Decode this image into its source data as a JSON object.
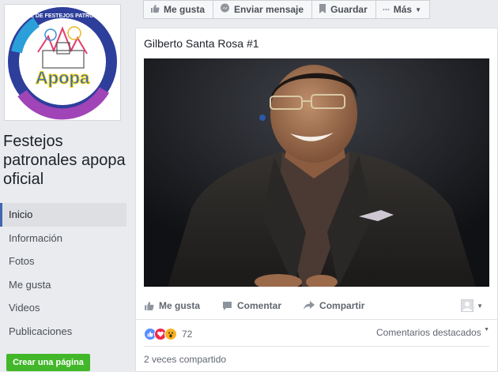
{
  "page": {
    "logo_text_top": "COMITE DE FESTEJOS PATRONALES",
    "logo_text_brand": "Apopa",
    "name": "Festejos patronales apopa oficial"
  },
  "nav": {
    "items": [
      {
        "label": "Inicio",
        "active": true
      },
      {
        "label": "Información"
      },
      {
        "label": "Fotos"
      },
      {
        "label": "Me gusta"
      },
      {
        "label": "Videos"
      },
      {
        "label": "Publicaciones"
      }
    ],
    "create_page": "Crear una página"
  },
  "actionbar": {
    "like": "Me gusta",
    "message": "Enviar mensaje",
    "save": "Guardar",
    "more_dots": "···",
    "more": "Más"
  },
  "post": {
    "title": "Gilberto Santa Rosa #1",
    "actions": {
      "like": "Me gusta",
      "comment": "Comentar",
      "share": "Compartir"
    },
    "reactions": {
      "count": "72",
      "types": [
        "like-icon",
        "love-icon",
        "wow-icon"
      ]
    },
    "featured_comments": "Comentarios destacados",
    "shares": "2 veces compartido"
  },
  "colors": {
    "brand_blue": "#4267b2",
    "create_green": "#42b72a",
    "like_blue": "#598cff",
    "love_red": "#f0284a",
    "wow_yellow": "#f7b125"
  }
}
